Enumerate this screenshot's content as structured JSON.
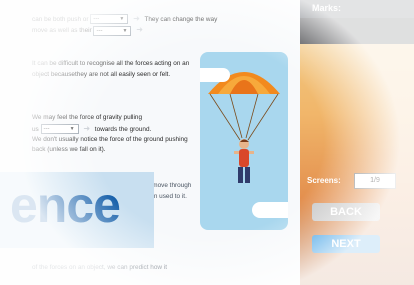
{
  "content": {
    "p1_line1_a": "can be both push or",
    "p1_line1_dd": "---",
    "p1_line1_b": "They can change the way",
    "p1_line2_a": "move as well as their",
    "p1_line2_dd": "---",
    "p2": "It can be difficult to recognise all the forces acting on an object becausethey are not all easily seen or felt.",
    "p3_a": "We may feel the force of gravity pulling",
    "p3_us": "us",
    "p3_dd": "---",
    "p3_b": "towards the ground.",
    "p3_c": "We don't usually notice the force of the ground pushing back (unless we fall on it).",
    "p4": "We may feel a resistance force if we try to move through water or air. However, we resistance force in used to it.",
    "p5": "of the forces on an object, we can predict how it"
  },
  "banner": {
    "text": "ence"
  },
  "sidebar": {
    "marks_label": "Marks:",
    "screens_label": "Screens:",
    "screens_value": "1/9",
    "back_label": "BACK",
    "next_label": "NEXT"
  }
}
